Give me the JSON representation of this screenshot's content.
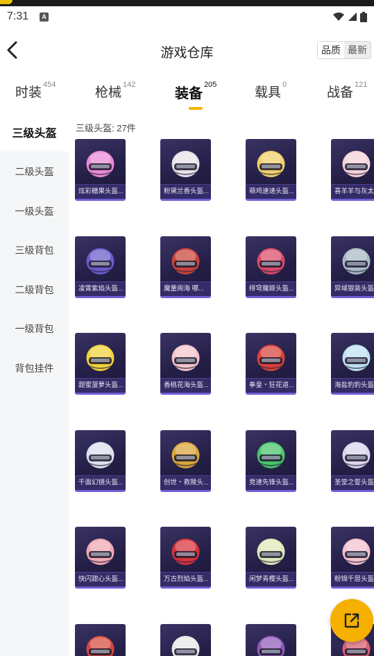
{
  "status": {
    "time": "7:31",
    "app_badge": "A"
  },
  "header": {
    "title": "游戏仓库",
    "back_icon": "chevron-left-icon"
  },
  "sort": {
    "options": [
      "品质",
      "最新"
    ],
    "selected": "品质"
  },
  "tabs": [
    {
      "label": "时装",
      "count": "454"
    },
    {
      "label": "枪械",
      "count": "142"
    },
    {
      "label": "装备",
      "count": "205",
      "active": true
    },
    {
      "label": "载具",
      "count": "0"
    },
    {
      "label": "战备",
      "count": "121"
    }
  ],
  "sidebar": {
    "items": [
      {
        "label": "三级头盔",
        "active": true
      },
      {
        "label": "二级头盔"
      },
      {
        "label": "一级头盔"
      },
      {
        "label": "三级背包"
      },
      {
        "label": "二级背包"
      },
      {
        "label": "一级背包"
      },
      {
        "label": "背包挂件"
      }
    ]
  },
  "section": {
    "title": "三级头盔: 27件"
  },
  "items": [
    {
      "name": "炫彩糖果头盔...",
      "color": "#e98ad6"
    },
    {
      "name": "粉黛兰香头盔...",
      "color": "#e9e2ea"
    },
    {
      "name": "萌鸡速递头盔...",
      "color": "#f0cf6a"
    },
    {
      "name": "喜羊羊与灰太",
      "color": "#f4d2d8"
    },
    {
      "name": "凌霄紫焰头盔...",
      "color": "#6a5bc9"
    },
    {
      "name": "魔童闹海 哪...",
      "color": "#c9433a"
    },
    {
      "name": "绯穹魔姬头盔...",
      "color": "#d94a6a"
    },
    {
      "name": "异域银装头盔",
      "color": "#a9bac4"
    },
    {
      "name": "甜蜜菠萝头盔...",
      "color": "#f2d23a"
    },
    {
      "name": "香桃花海头盔...",
      "color": "#f3c4cb"
    },
    {
      "name": "拳皇・狂花道...",
      "color": "#d9423a"
    },
    {
      "name": "海盐豹豹头盔",
      "color": "#bfe1f0"
    },
    {
      "name": "千面幻镜头盔...",
      "color": "#d9e0ee"
    },
    {
      "name": "创世・救赎头...",
      "color": "#d8a53a"
    },
    {
      "name": "竞速先锋头盔...",
      "color": "#49c46a"
    },
    {
      "name": "圣堂之誓头盔",
      "color": "#d9d6ea"
    },
    {
      "name": "快闪甜心头盔...",
      "color": "#f1a7b4"
    },
    {
      "name": "万古烈焰头盔...",
      "color": "#d6333a"
    },
    {
      "name": "闲梦青樱头盔...",
      "color": "#dfe9b9"
    },
    {
      "name": "粉锦千层头盔",
      "color": "#f3c3cf"
    },
    {
      "name": "",
      "color": "#d54a3f"
    },
    {
      "name": "",
      "color": "#e8e8e8"
    },
    {
      "name": "",
      "color": "#8f5bb8"
    },
    {
      "name": "",
      "color": "#d95f71"
    }
  ],
  "fab": {
    "icon": "share-icon"
  }
}
